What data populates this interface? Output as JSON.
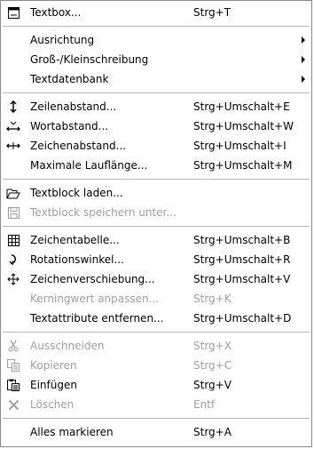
{
  "menu": {
    "textbox": {
      "label": "Textbox...",
      "shortcut": "Strg+T",
      "icon": "textbox-icon"
    },
    "ausrichtung": {
      "label": "Ausrichtung"
    },
    "gross_klein": {
      "label": "Groß-/Kleinschreibung"
    },
    "textdatenbank": {
      "label": "Textdatenbank"
    },
    "zeilenabstand": {
      "label": "Zeilenabstand...",
      "shortcut": "Strg+Umschalt+E",
      "icon": "line-spacing-icon"
    },
    "wortabstand": {
      "label": "Wortabstand...",
      "shortcut": "Strg+Umschalt+W",
      "icon": "word-spacing-icon"
    },
    "zeichenabstand": {
      "label": "Zeichenabstand...",
      "shortcut": "Strg+Umschalt+I",
      "icon": "char-spacing-icon"
    },
    "max_lauflaenge": {
      "label": "Maximale Lauflänge...",
      "shortcut": "Strg+Umschalt+M"
    },
    "textblock_laden": {
      "label": "Textblock laden...",
      "icon": "open-folder-icon"
    },
    "textblock_speichern": {
      "label": "Textblock speichern unter...",
      "icon": "save-disk-icon"
    },
    "zeichentabelle": {
      "label": "Zeichentabelle...",
      "shortcut": "Strg+Umschalt+B",
      "icon": "char-table-icon"
    },
    "rotationswinkel": {
      "label": "Rotationswinkel...",
      "shortcut": "Strg+Umschalt+R",
      "icon": "rotate-icon"
    },
    "zeichenverschiebung": {
      "label": "Zeichenverschiebung...",
      "shortcut": "Strg+Umschalt+V",
      "icon": "move-arrows-icon"
    },
    "kerningwert": {
      "label": "Kerningwert anpassen...",
      "shortcut": "Strg+K"
    },
    "textattribute": {
      "label": "Textattribute entfernen...",
      "shortcut": "Strg+Umschalt+D"
    },
    "ausschneiden": {
      "label": "Ausschneiden",
      "shortcut": "Strg+X",
      "icon": "scissors-icon"
    },
    "kopieren": {
      "label": "Kopieren",
      "shortcut": "Strg+C",
      "icon": "copy-icon"
    },
    "einfuegen": {
      "label": "Einfügen",
      "shortcut": "Strg+V",
      "icon": "paste-icon"
    },
    "loeschen": {
      "label": "Löschen",
      "shortcut": "Entf",
      "icon": "delete-x-icon"
    },
    "alles_markieren": {
      "label": "Alles markieren",
      "shortcut": "Strg+A"
    }
  }
}
